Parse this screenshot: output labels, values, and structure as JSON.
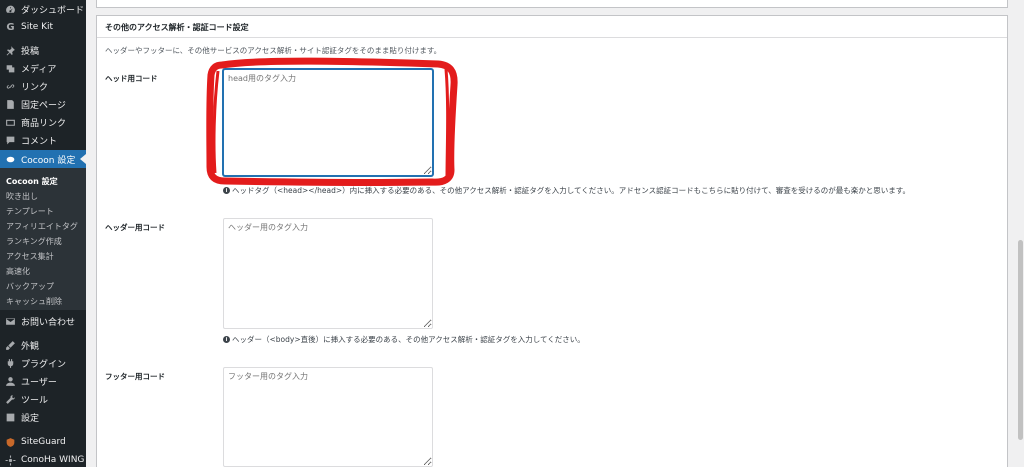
{
  "sidebar": {
    "items": [
      {
        "label": "ダッシュボード",
        "icon": "dashboard-icon"
      },
      {
        "label": "Site Kit",
        "icon": "sitekit-icon"
      },
      {
        "label": "投稿",
        "icon": "pin-icon"
      },
      {
        "label": "メディア",
        "icon": "media-icon"
      },
      {
        "label": "リンク",
        "icon": "link-icon"
      },
      {
        "label": "固定ページ",
        "icon": "page-icon"
      },
      {
        "label": "商品リンク",
        "icon": "product-link-icon"
      },
      {
        "label": "コメント",
        "icon": "comment-icon"
      },
      {
        "label": "Cocoon 設定",
        "icon": "cocoon-icon",
        "active": true
      },
      {
        "label": "お問い合わせ",
        "icon": "mail-icon"
      },
      {
        "label": "外観",
        "icon": "appearance-icon"
      },
      {
        "label": "プラグイン",
        "icon": "plugin-icon"
      },
      {
        "label": "ユーザー",
        "icon": "user-icon"
      },
      {
        "label": "ツール",
        "icon": "tool-icon"
      },
      {
        "label": "設定",
        "icon": "settings-icon"
      },
      {
        "label": "SiteGuard",
        "icon": "siteguard-icon"
      },
      {
        "label": "ConoHa WING",
        "icon": "conoha-icon"
      }
    ],
    "submenu": [
      {
        "label": "Cocoon 設定",
        "current": true
      },
      {
        "label": "吹き出し"
      },
      {
        "label": "テンプレート"
      },
      {
        "label": "アフィリエイトタグ"
      },
      {
        "label": "ランキング作成"
      },
      {
        "label": "アクセス集計"
      },
      {
        "label": "高速化"
      },
      {
        "label": "バックアップ"
      },
      {
        "label": "キャッシュ削除"
      }
    ]
  },
  "panel": {
    "title": "その他のアクセス解析・認証コード設定",
    "description": "ヘッダーやフッターに、その他サービスのアクセス解析・サイト認証タグをそのまま貼り付けます。",
    "fields": [
      {
        "label": "ヘッド用コード",
        "placeholder": "head用のタグ入力",
        "hint": "ヘッドタグ（<head></head>）内に挿入する必要のある、その他アクセス解析・認証タグを入力してください。アドセンス認証コードもこちらに貼り付けて、審査を受けるのが最も楽かと思います。"
      },
      {
        "label": "ヘッダー用コード",
        "placeholder": "ヘッダー用のタグ入力",
        "hint": "ヘッダー（<body>直後）に挿入する必要のある、その他アクセス解析・認証タグを入力してください。"
      },
      {
        "label": "フッター用コード",
        "placeholder": "フッター用のタグ入力"
      }
    ]
  },
  "colors": {
    "sidebar_bg": "#1d2327",
    "accent": "#2271b1",
    "annotation": "#e31c1c"
  }
}
